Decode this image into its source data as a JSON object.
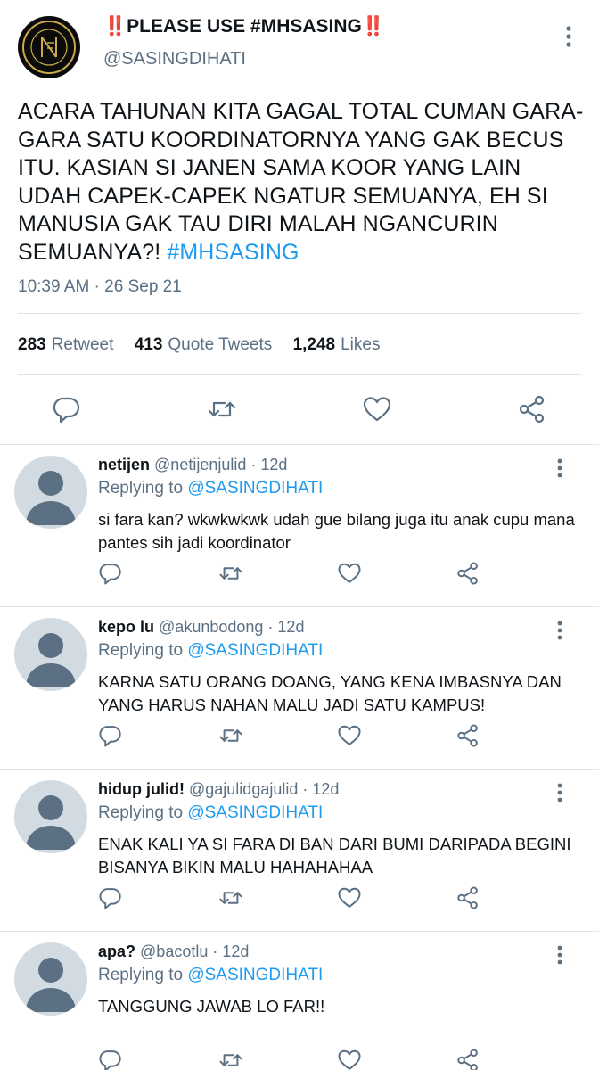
{
  "main_tweet": {
    "display_name": "PLEASE USE #MHSASING",
    "bang_left": "‼️",
    "bang_right": "‼️",
    "handle": "@SASINGDIHATI",
    "text": "ACARA TAHUNAN KITA GAGAL TOTAL CUMAN GARA-GARA SATU KOORDINATORNYA YANG GAK BECUS ITU. KASIAN SI JANEN SAMA KOOR YANG LAIN UDAH CAPEK-CAPEK NGATUR SEMUANYA, EH SI MANUSIA GAK TAU DIRI MALAH NGANCURIN SEMUANYA?!",
    "hashtag": "#MHSASING",
    "timestamp": "10:39 AM · 26 Sep 21",
    "stats": {
      "retweets_count": "283",
      "retweets_label": "Retweet",
      "quotes_count": "413",
      "quotes_label": "Quote Tweets",
      "likes_count": "1,248",
      "likes_label": "Likes"
    }
  },
  "replies": [
    {
      "name": "netijen",
      "handle": "@netijenjulid",
      "time": "· 12d",
      "replying_prefix": "Replying to",
      "replying_to": "@SASINGDIHATI",
      "text": "si fara kan? wkwkwkwk udah gue bilang juga itu anak cupu mana pantes sih jadi koordinator"
    },
    {
      "name": "kepo lu",
      "handle": "@akunbodong",
      "time": "· 12d",
      "replying_prefix": "Replying to",
      "replying_to": "@SASINGDIHATI",
      "text": "KARNA SATU ORANG DOANG, YANG KENA IMBASNYA DAN YANG HARUS NAHAN MALU JADI SATU KAMPUS!"
    },
    {
      "name": "hidup julid!",
      "handle": "@gajulidgajulid",
      "time": "· 12d",
      "replying_prefix": "Replying to",
      "replying_to": "@SASINGDIHATI",
      "text": "ENAK KALI YA SI FARA DI BAN DARI BUMI DARIPADA BEGINI BISANYA BIKIN MALU HAHAHAHAA"
    },
    {
      "name": "apa?",
      "handle": "@bacotlu",
      "time": "· 12d",
      "replying_prefix": "Replying to",
      "replying_to": "@SASINGDIHATI",
      "text": "TANGGUNG JAWAB LO FAR!!"
    }
  ],
  "colors": {
    "accent": "#1d9bf0",
    "secondary_text": "#5b7083",
    "icon_gray": "#5b7083",
    "divider": "#dfe5ea",
    "avatar_bg": "#d3dbe2",
    "avatar_fg": "#5b7083"
  },
  "icons": [
    "more-vertical-icon",
    "reply-icon",
    "retweet-icon",
    "like-icon",
    "share-icon"
  ]
}
